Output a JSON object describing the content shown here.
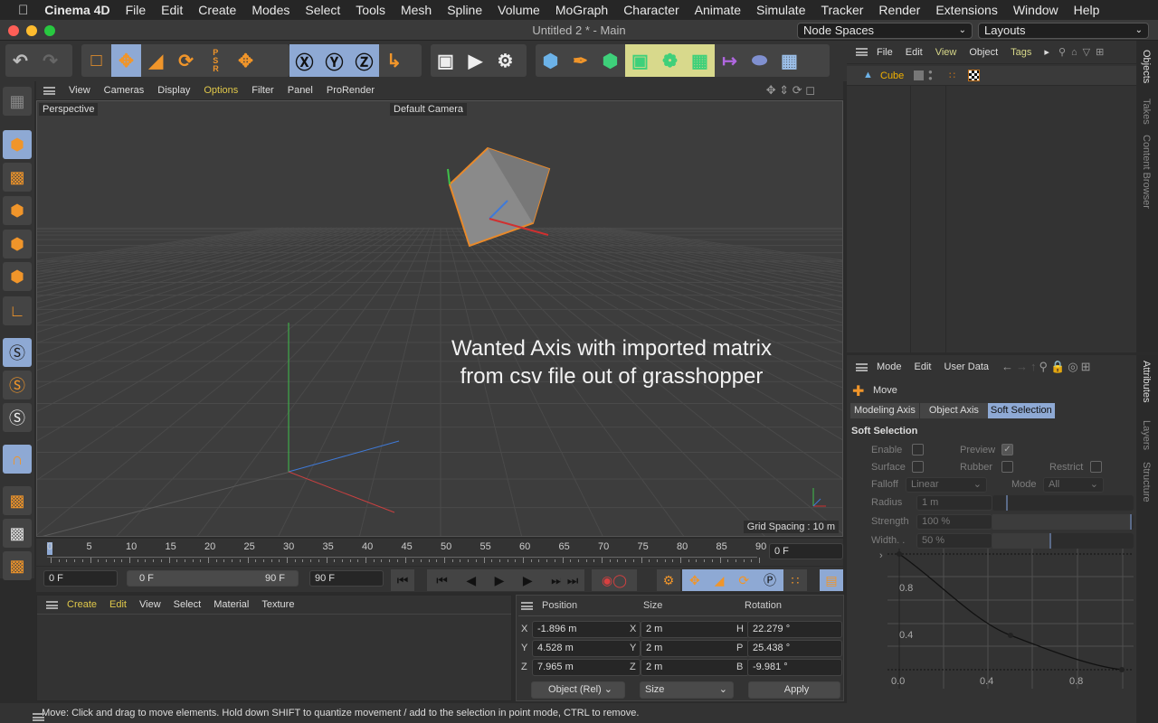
{
  "menubar": {
    "app": "Cinema 4D",
    "items": [
      "File",
      "Edit",
      "Create",
      "Modes",
      "Select",
      "Tools",
      "Mesh",
      "Spline",
      "Volume",
      "MoGraph",
      "Character",
      "Animate",
      "Simulate",
      "Tracker",
      "Render",
      "Extensions",
      "Window",
      "Help"
    ]
  },
  "window": {
    "title": "Untitled 2 * - Main",
    "node_spaces": "Node Spaces",
    "layouts": "Layouts"
  },
  "viewport": {
    "menu": [
      "View",
      "Cameras",
      "Display",
      "Options",
      "Filter",
      "Panel",
      "ProRender"
    ],
    "active_menu": "Options",
    "view_name": "Perspective",
    "camera": "Default Camera",
    "grid_spacing": "Grid Spacing : 10 m",
    "annotation": "Wanted Axis with imported matrix from csv file out of grasshopper"
  },
  "timeline": {
    "ticks": [
      "0",
      "5",
      "10",
      "15",
      "20",
      "25",
      "30",
      "35",
      "40",
      "45",
      "50",
      "55",
      "60",
      "65",
      "70",
      "75",
      "80",
      "85",
      "90"
    ],
    "current_frame": "0 F",
    "start": "0 F",
    "range_start": "0 F",
    "range_end": "90 F",
    "end": "90 F"
  },
  "material_manager": {
    "menu": [
      "Create",
      "Edit",
      "View",
      "Select",
      "Material",
      "Texture"
    ]
  },
  "coordinates": {
    "headers": [
      "Position",
      "Size",
      "Rotation"
    ],
    "rows": [
      {
        "pl": "X",
        "pv": "-1.896 m",
        "sl": "X",
        "sv": "2 m",
        "rl": "H",
        "rv": "22.279 °"
      },
      {
        "pl": "Y",
        "pv": "4.528 m",
        "sl": "Y",
        "sv": "2 m",
        "rl": "P",
        "rv": "25.438 °"
      },
      {
        "pl": "Z",
        "pv": "7.965 m",
        "sl": "Z",
        "sv": "2 m",
        "rl": "B",
        "rv": "-9.981 °"
      }
    ],
    "mode": "Object (Rel)",
    "size_mode": "Size",
    "apply": "Apply"
  },
  "status": "Move: Click and drag to move elements. Hold down SHIFT to quantize movement / add to the selection in point mode, CTRL to remove.",
  "objects": {
    "menu": [
      "File",
      "Edit",
      "View",
      "Object",
      "Tags"
    ],
    "items": [
      {
        "name": "Cube"
      }
    ]
  },
  "right_tabs_top": [
    "Objects",
    "Takes",
    "Content Browser"
  ],
  "right_tabs_bottom": [
    "Attributes",
    "Layers",
    "Structure"
  ],
  "attributes": {
    "menu": [
      "Mode",
      "Edit",
      "User Data"
    ],
    "tool": "Move",
    "tabs": [
      "Modeling Axis",
      "Object Axis",
      "Soft Selection"
    ],
    "active_tab": "Soft Selection",
    "section": "Soft Selection",
    "enable": "Enable",
    "preview": "Preview",
    "surface": "Surface",
    "rubber": "Rubber",
    "restrict": "Restrict",
    "falloff": "Falloff",
    "falloff_value": "Linear",
    "mode": "Mode",
    "mode_value": "All",
    "radius": "Radius",
    "radius_value": "1 m",
    "strength": "Strength",
    "strength_value": "100 %",
    "width": "Width. .",
    "width_value": "50 %",
    "strength_fraction": 1.0,
    "width_fraction": 0.5,
    "curve_y_ticks": [
      "0.8",
      "0.4"
    ],
    "curve_x_ticks": [
      "0.0",
      "0.4",
      "0.8"
    ]
  },
  "colors": {
    "accent_blue": "#8ea9d4",
    "orange": "#f0952a",
    "highlight_yellow": "#e0c84a"
  }
}
